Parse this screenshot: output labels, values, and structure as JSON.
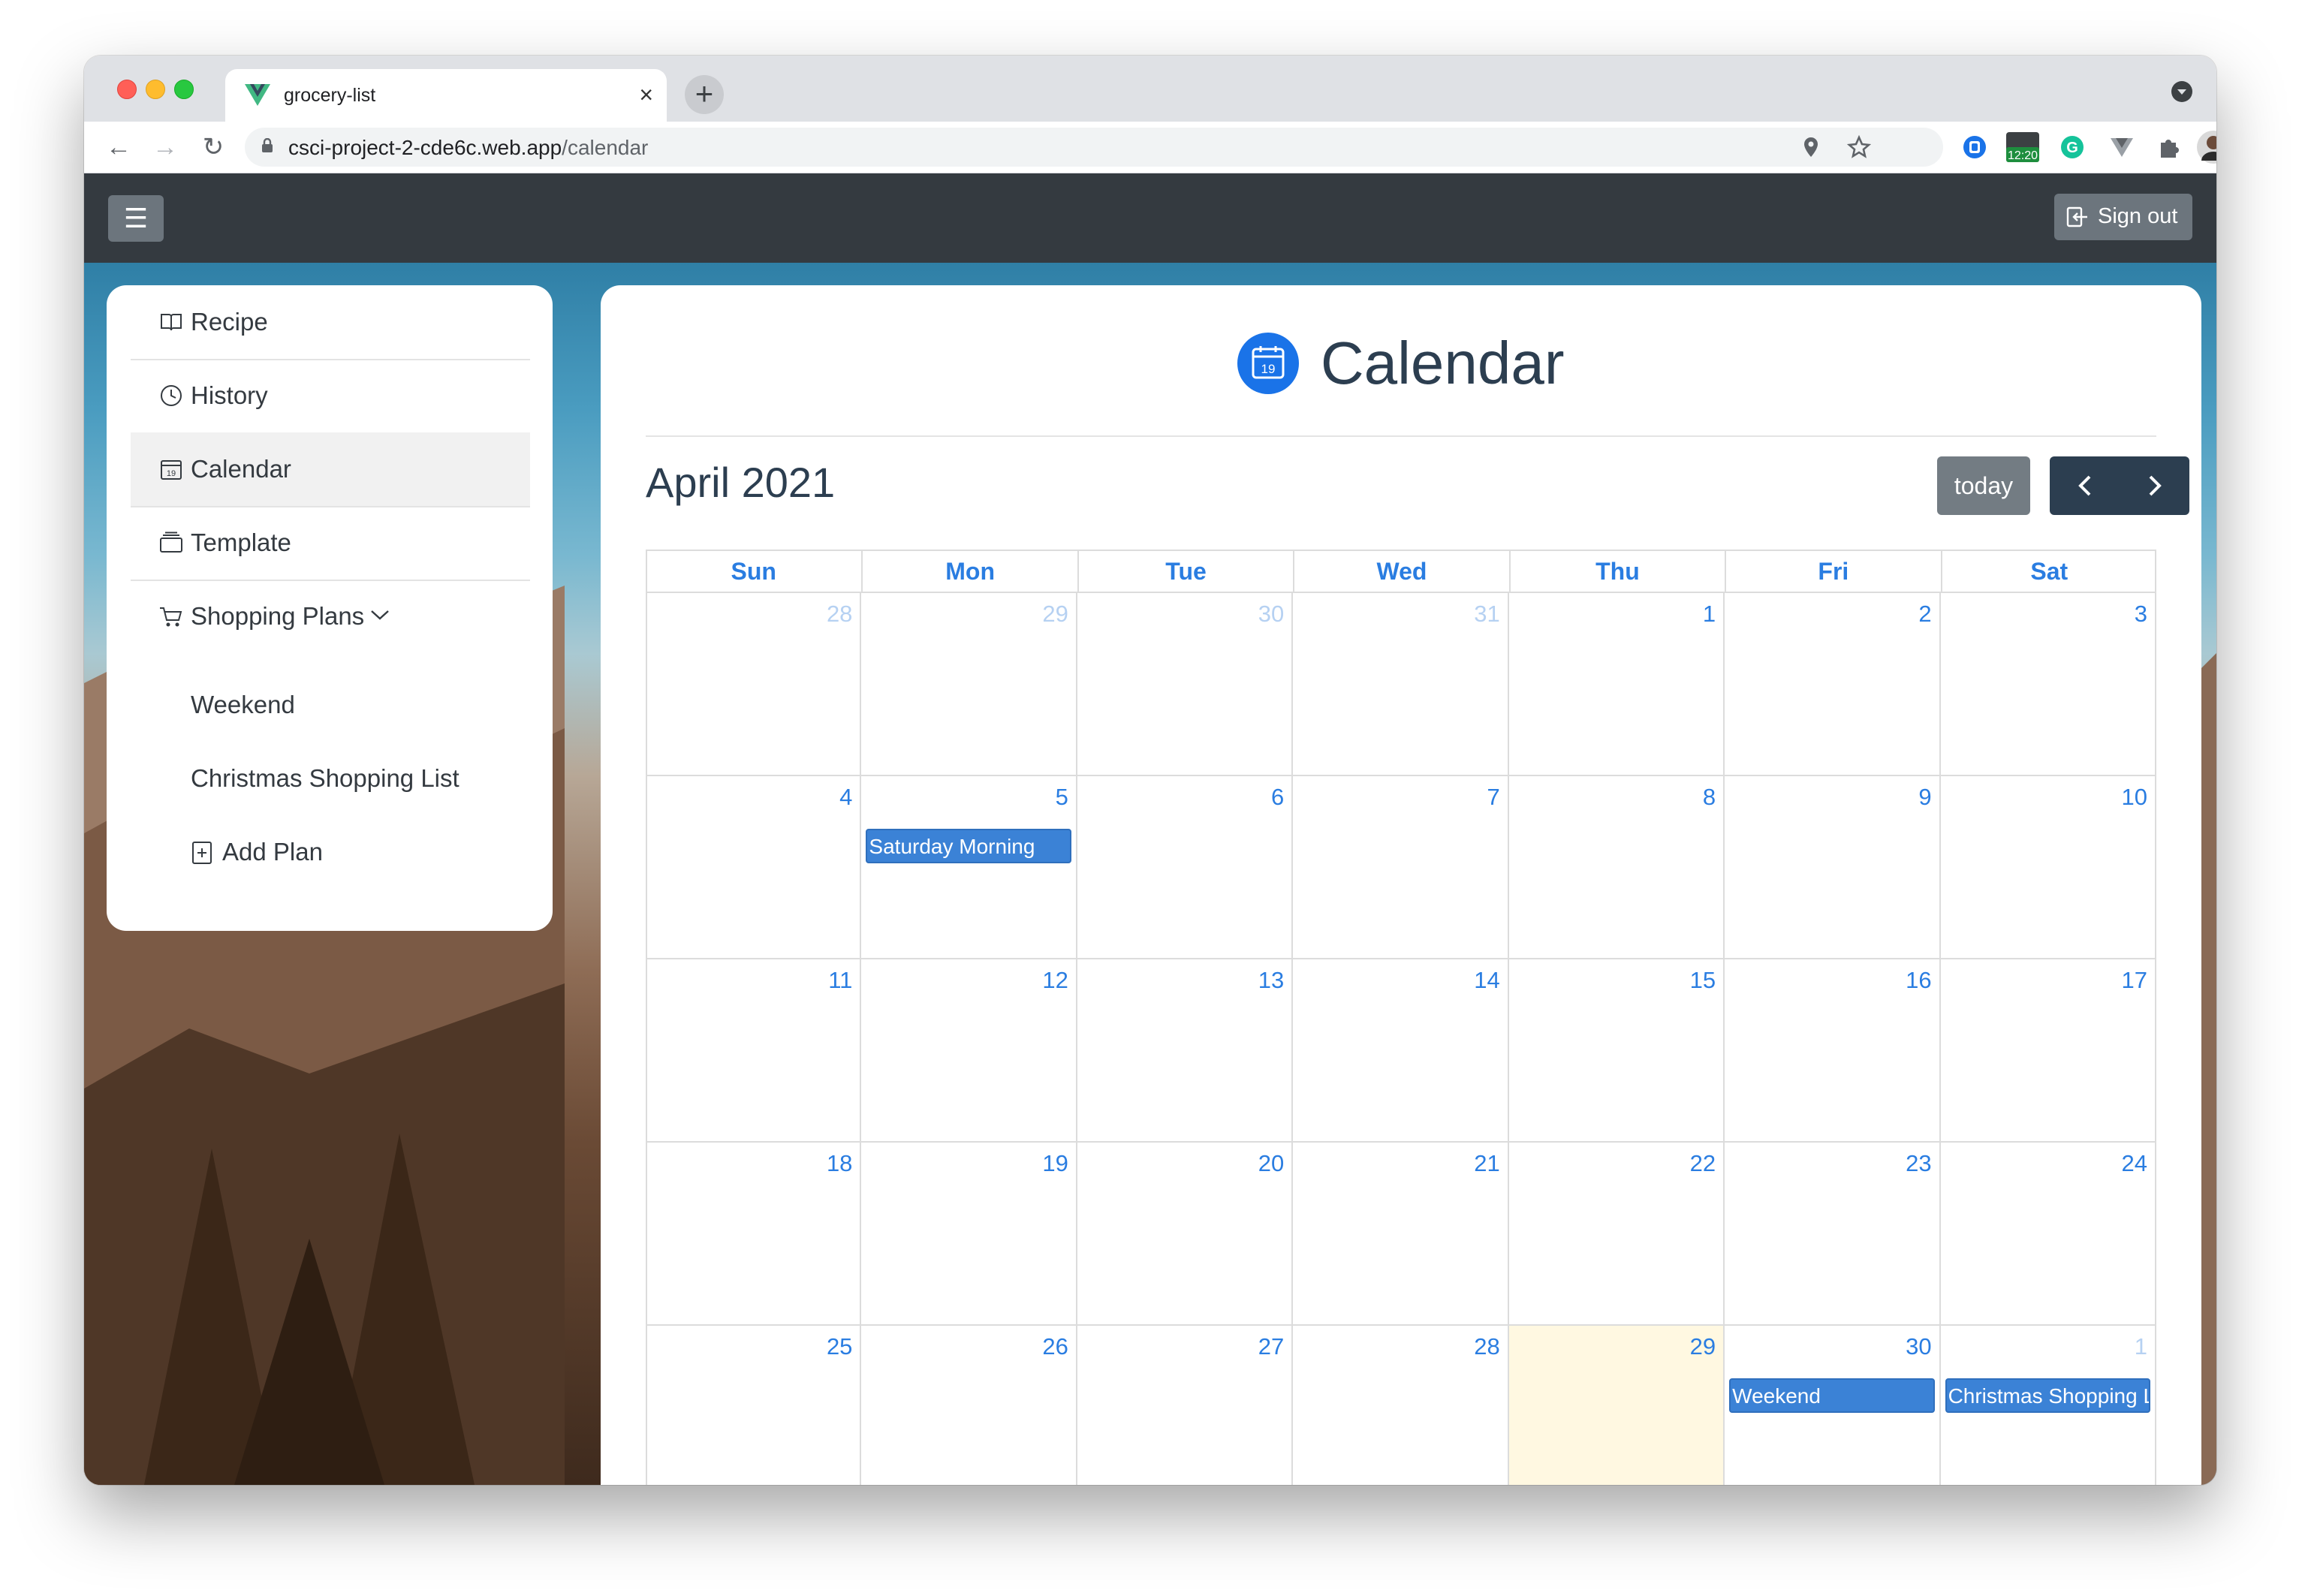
{
  "browser": {
    "tab_title": "grocery-list",
    "url_host": "csci-project-2-cde6c.web.app",
    "url_path": "/calendar",
    "clock_badge": "12:20",
    "extension_initial": "G"
  },
  "app": {
    "menu_icon": "☰",
    "signout_label": "Sign out"
  },
  "sidebar": {
    "items": [
      {
        "label": "Recipe",
        "icon": "book-icon"
      },
      {
        "label": "History",
        "icon": "clock-icon"
      },
      {
        "label": "Calendar",
        "icon": "calendar-icon"
      },
      {
        "label": "Template",
        "icon": "template-icon"
      },
      {
        "label": "Shopping Plans",
        "icon": "cart-icon"
      }
    ],
    "plans": [
      "Weekend",
      "Christmas Shopping List"
    ],
    "add_plan_label": "Add Plan"
  },
  "main": {
    "page_title": "Calendar",
    "badge_number": "19",
    "month_title": "April 2021",
    "today_label": "today",
    "prev_icon": "‹",
    "next_icon": "›",
    "weekdays": [
      "Sun",
      "Mon",
      "Tue",
      "Wed",
      "Thu",
      "Fri",
      "Sat"
    ],
    "weeks": [
      [
        "28",
        "29",
        "30",
        "31",
        "1",
        "2",
        "3"
      ],
      [
        "4",
        "5",
        "6",
        "7",
        "8",
        "9",
        "10"
      ],
      [
        "11",
        "12",
        "13",
        "14",
        "15",
        "16",
        "17"
      ],
      [
        "18",
        "19",
        "20",
        "21",
        "22",
        "23",
        "24"
      ],
      [
        "25",
        "26",
        "27",
        "28",
        "29",
        "30",
        "1"
      ]
    ],
    "events": {
      "saturday_morning": "Saturday Morning",
      "weekend": "Weekend",
      "christmas": "Christmas Shopping Li"
    }
  },
  "colors": {
    "appbar": "#343a40",
    "accent": "#2a7de1",
    "event": "#3b82d6",
    "today_cell": "#fff8e1"
  }
}
